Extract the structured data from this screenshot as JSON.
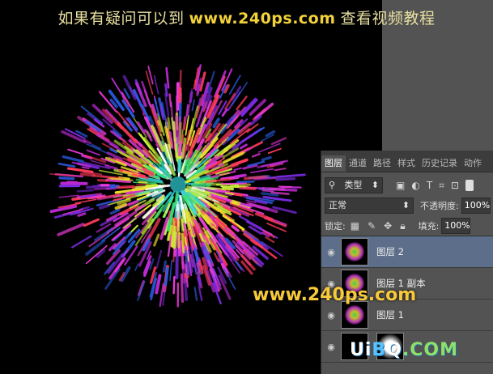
{
  "banner": {
    "left_text": "如果有疑问可以到",
    "url": "www.240ps.com",
    "right_text": "查看视频教程"
  },
  "watermark": {
    "url": "www.240ps.com",
    "site_u": "U",
    "site_i": "i",
    "site_b": "B",
    "site_q": "Q",
    "site_rest": ".COM"
  },
  "panel": {
    "tabs": [
      "图层",
      "通道",
      "路径",
      "样式",
      "历史记录",
      "动作"
    ],
    "filter_kind": "类型",
    "blend_mode": "正常",
    "opacity_label": "不透明度:",
    "opacity_value": "100%",
    "lock_label": "锁定:",
    "fill_label": "填充:",
    "fill_value": "100%",
    "layers": [
      {
        "name": "图层 2",
        "selected": true
      },
      {
        "name": "图层 1 副本",
        "selected": false
      },
      {
        "name": "图层 1",
        "selected": false
      },
      {
        "name": "",
        "selected": false
      }
    ]
  },
  "colors": {
    "panel_bg": "#535353",
    "selected_layer": "#5c6e89",
    "banner_url": "#f2d23a"
  },
  "icons": {
    "filter": "search-icon",
    "image_filter": "image-icon",
    "adjust_filter": "circle-half-icon",
    "text_filter": "text-icon",
    "shape_filter": "shape-icon",
    "smart_filter": "smart-object-icon",
    "lock_pixels": "checkerboard-icon",
    "lock_paint": "brush-icon",
    "lock_move": "move-icon",
    "lock_all": "lock-icon",
    "visibility": "eye-icon"
  }
}
